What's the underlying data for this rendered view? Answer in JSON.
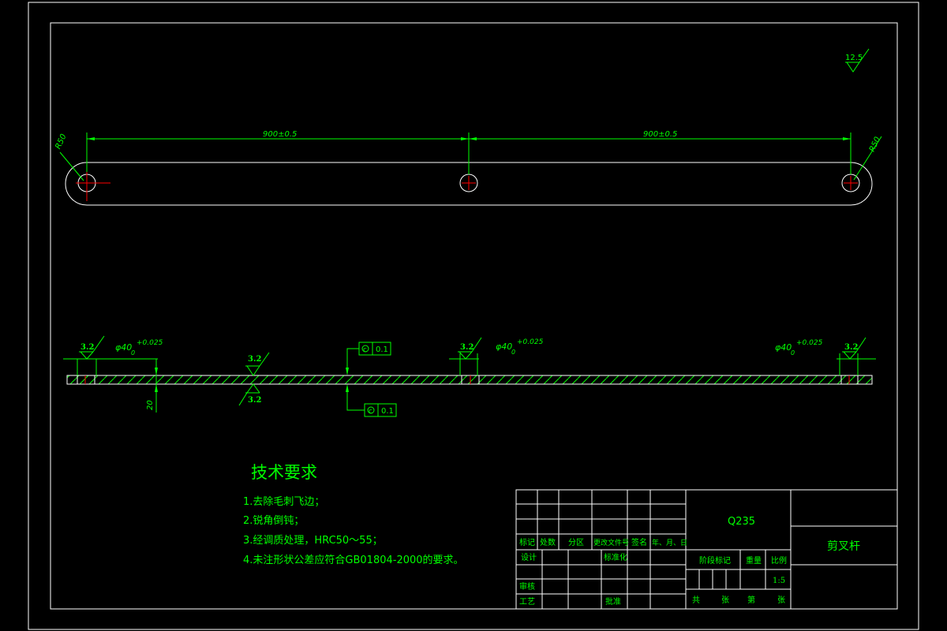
{
  "colors": {
    "background": "#000000",
    "frame": "#ffffff",
    "annotation": "#00ff00",
    "centerline": "#ff0000"
  },
  "top_view": {
    "dim_left": "900±0.5",
    "dim_right": "900±0.5",
    "radius_left": "R50",
    "radius_right": "R50"
  },
  "roughness_general": "12.5",
  "side_view": {
    "roughness": [
      "3.2",
      "3.2",
      "3.2",
      "3.2",
      "3.2"
    ],
    "hole_dia": [
      "φ40",
      "φ40",
      "φ40"
    ],
    "hole_tol_upper": "+0.025",
    "hole_tol_lower": "0",
    "thickness": "20",
    "parallel_top": {
      "datum": "c",
      "value": "0.1"
    },
    "parallel_bottom": {
      "datum": "c",
      "value": "0.1"
    }
  },
  "requirements": {
    "title": "技术要求",
    "items": [
      "1.去除毛刺飞边；",
      "2.锐角倒钝；",
      "3.经调质处理，HRC50～55；",
      "4.未注形状公差应符合GB01804-2000的要求。"
    ]
  },
  "title_block": {
    "material": "Q235",
    "part_name": "剪叉杆",
    "row_labels": [
      "标记",
      "处数",
      "分区",
      "更改文件号",
      "签名",
      "年、月、日"
    ],
    "design": "设计",
    "standardize": "标准化",
    "stage_mark": "阶段标记",
    "weight": "重量",
    "scale_label": "比例",
    "scale_value": "1:5",
    "review": "审核",
    "process": "工艺",
    "approve": "批准",
    "total_label": "共",
    "sheets_label": "张",
    "page_label": "第",
    "page_sheets_label": "张"
  }
}
